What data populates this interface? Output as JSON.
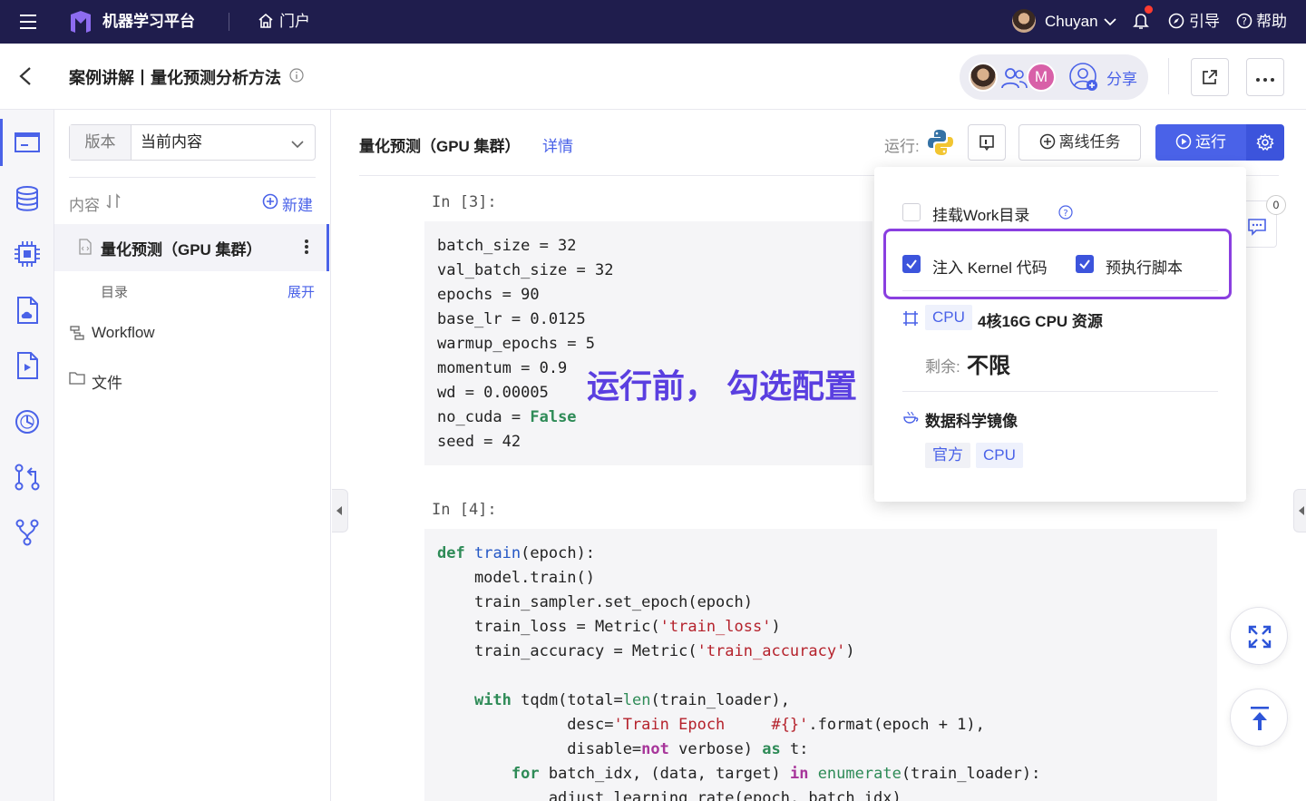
{
  "topbar": {
    "app_name": "机器学习平台",
    "portal": "门户",
    "user_name": "Chuyan",
    "guide": "引导",
    "help": "帮助"
  },
  "header": {
    "title": "案例讲解丨量化预测分析方法",
    "avatar_initial": "M",
    "share": "分享"
  },
  "sidebar": {
    "version_label": "版本",
    "version_value": "当前内容",
    "content_label": "内容",
    "new_button": "新建",
    "notebook_name": "量化预测（GPU 集群）",
    "toc_label": "目录",
    "expand_label": "展开",
    "workflow_label": "Workflow",
    "files_label": "文件"
  },
  "toolbar": {
    "notebook_title": "量化预测（GPU 集群）",
    "details_link": "详情",
    "run_label": "运行:",
    "offline_task": "离线任务",
    "run_button": "运行"
  },
  "cells": [
    {
      "prompt": "In [3]:",
      "lines": [
        "batch_size = 32",
        "val_batch_size = 32",
        "epochs = 90",
        "base_lr = 0.0125",
        "warmup_epochs = 5",
        "momentum = 0.9",
        "wd = 0.00005",
        "no_cuda = False",
        "seed = 42"
      ]
    },
    {
      "prompt": "In [4]:",
      "lines": [
        "def train(epoch):",
        "    model.train()",
        "    train_sampler.set_epoch(epoch)",
        "    train_loss = Metric('train_loss')",
        "    train_accuracy = Metric('train_accuracy')",
        "",
        "    with tqdm(total=len(train_loader),",
        "              desc='Train Epoch     #{}'.format(epoch + 1),",
        "              disable=not verbose) as t:",
        "        for batch_idx, (data, target) in enumerate(train_loader):",
        "            adjust_learning_rate(epoch, batch_idx)"
      ]
    }
  ],
  "annotation": "运行前， 勾选配置",
  "comment_count": "0",
  "popover": {
    "mount_work": "挂载Work目录",
    "mount_work_checked": false,
    "inject_kernel": "注入 Kernel 代码",
    "inject_kernel_checked": true,
    "pre_script": "预执行脚本",
    "pre_script_checked": true,
    "cpu_tag": "CPU",
    "resource_name": "4核16G CPU 资源",
    "remaining_label": "剩余:",
    "remaining_value": "不限",
    "image_title": "数据科学镜像",
    "image_tags": [
      "官方",
      "CPU"
    ]
  },
  "colors": {
    "topbar_bg": "#1f1d4d",
    "accent": "#4a62e8",
    "highlight_border": "#8a3fe0",
    "annotation_text": "#5a3fe0"
  }
}
